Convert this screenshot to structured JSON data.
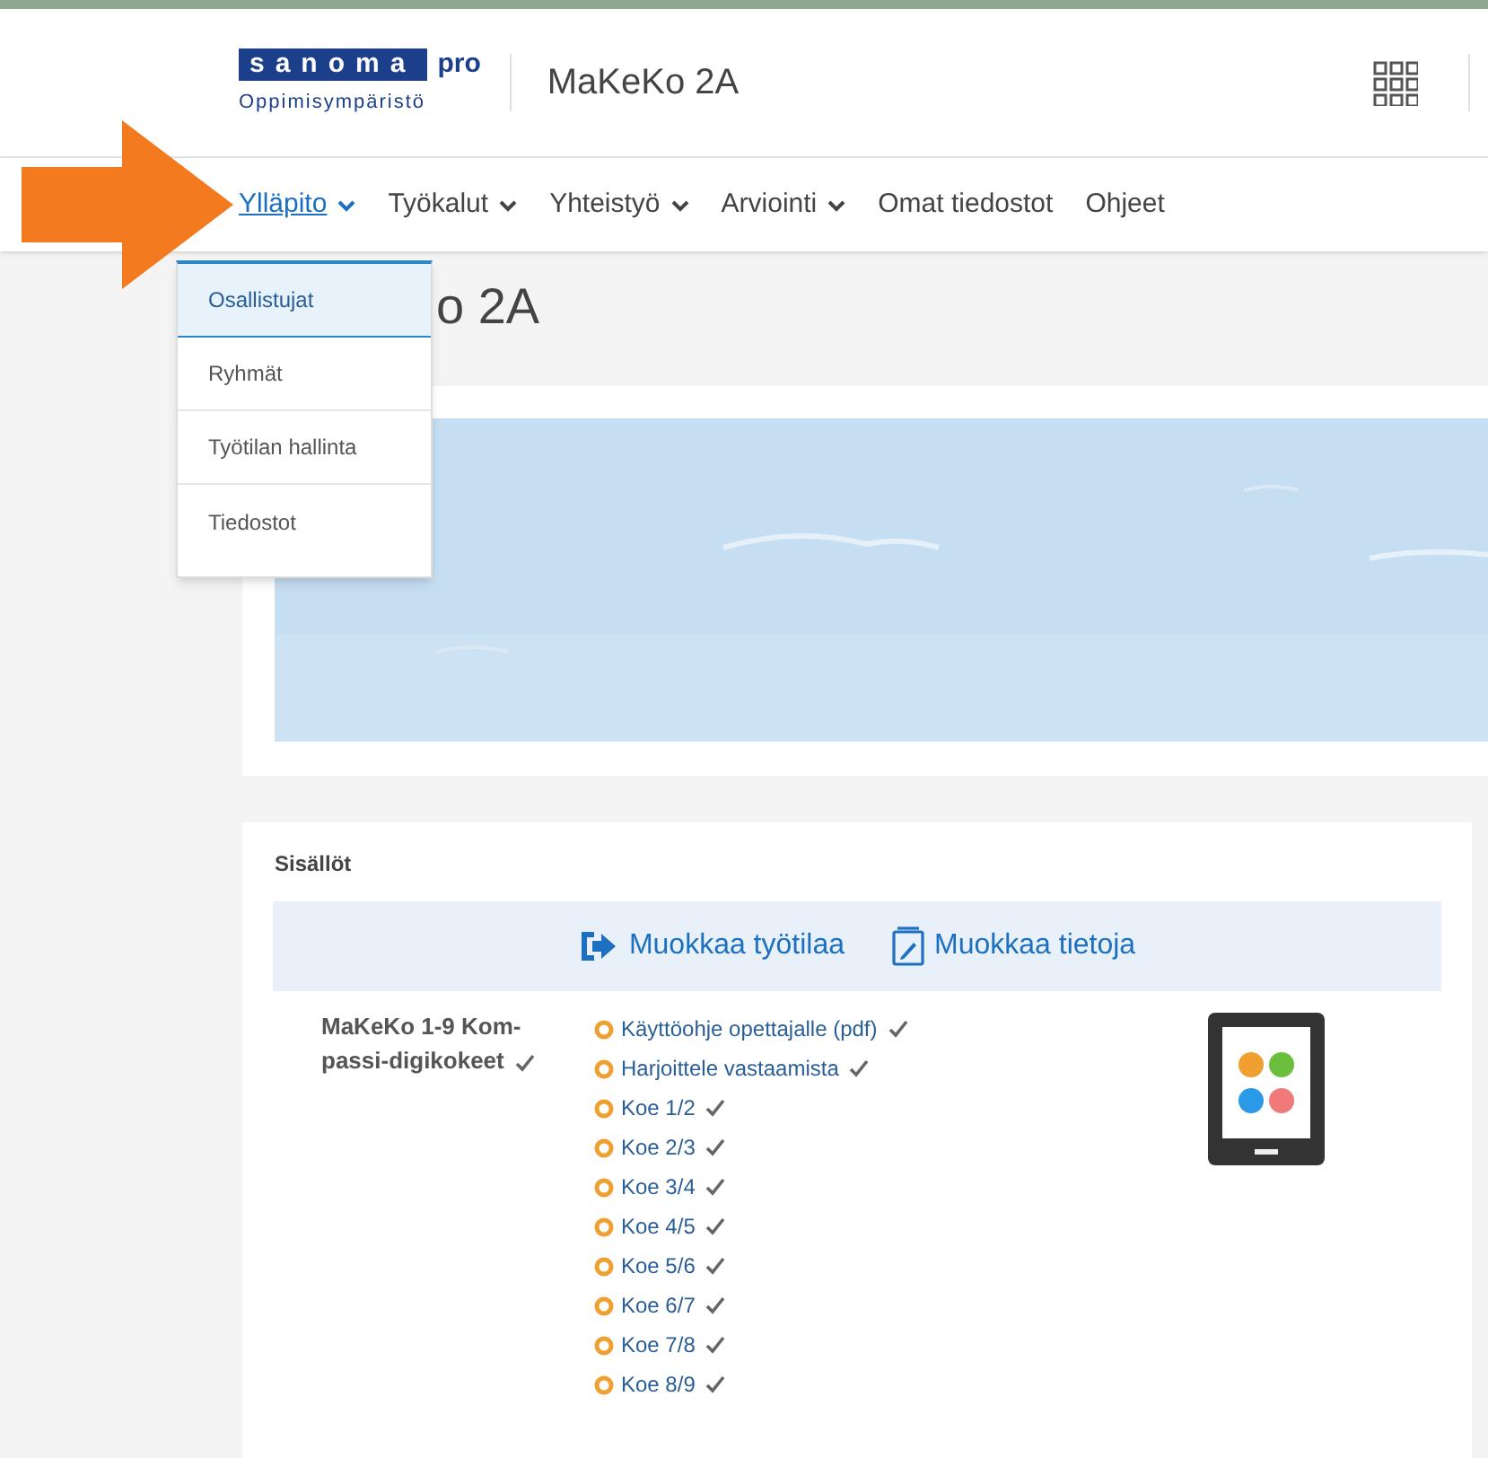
{
  "header": {
    "logo": {
      "brand": "sanoma",
      "suffix": "pro",
      "subtitle": "Oppimisympäristö"
    },
    "workspace": "MaKeKo 2A"
  },
  "nav": [
    {
      "label": "Ylläpito",
      "has_menu": true,
      "selected": true
    },
    {
      "label": "Työkalut",
      "has_menu": true,
      "selected": false
    },
    {
      "label": "Yhteistyö",
      "has_menu": true,
      "selected": false
    },
    {
      "label": "Arviointi",
      "has_menu": true,
      "selected": false
    },
    {
      "label": "Omat tiedostot",
      "has_menu": false,
      "selected": false
    },
    {
      "label": "Ohjeet",
      "has_menu": false,
      "selected": false
    }
  ],
  "dropdown": [
    {
      "label": "Osallistujat",
      "selected": true
    },
    {
      "label": "Ryhmät",
      "selected": false
    },
    {
      "label": "Työtilan hallinta",
      "selected": false
    },
    {
      "label": "Tiedostot",
      "selected": false
    }
  ],
  "page_title": "o 2A",
  "contents": {
    "heading": "Sisällöt",
    "actions": [
      {
        "label": "Muokkaa työtilaa",
        "kind": "edit-workspace"
      },
      {
        "label": "Muokkaa tietoja",
        "kind": "edit-info"
      }
    ],
    "module": {
      "title_lines": [
        "MaKeKo 1-9 Kom-",
        "passi-digikokeet"
      ],
      "completed": true,
      "items": [
        {
          "label": "Käyttöohje opettajalle (pdf)",
          "completed": true
        },
        {
          "label": "Harjoittele vastaamista",
          "completed": true
        },
        {
          "label": "Koe 1/2",
          "completed": true
        },
        {
          "label": "Koe 2/3",
          "completed": true
        },
        {
          "label": "Koe 3/4",
          "completed": true
        },
        {
          "label": "Koe 4/5",
          "completed": true
        },
        {
          "label": "Koe 5/6",
          "completed": true
        },
        {
          "label": "Koe 6/7",
          "completed": true
        },
        {
          "label": "Koe 7/8",
          "completed": true
        },
        {
          "label": "Koe 8/9",
          "completed": true
        }
      ]
    }
  }
}
